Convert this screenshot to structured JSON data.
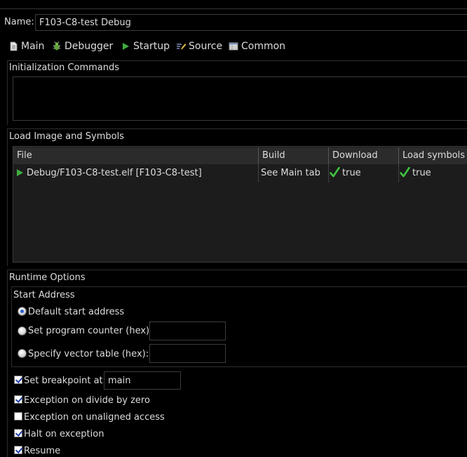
{
  "name": {
    "label": "Name:",
    "value": "F103-C8-test Debug"
  },
  "tabs": [
    {
      "label": "Main",
      "icon": "main-page-icon"
    },
    {
      "label": "Debugger",
      "icon": "debugger-bug-icon"
    },
    {
      "label": "Startup",
      "icon": "startup-play-icon"
    },
    {
      "label": "Source",
      "icon": "source-edit-icon"
    },
    {
      "label": "Common",
      "icon": "common-table-icon"
    }
  ],
  "init_commands": {
    "title": "Initialization Commands",
    "value": ""
  },
  "load_image": {
    "title": "Load Image and Symbols",
    "columns": [
      "File",
      "Build",
      "Download",
      "Load symbols"
    ],
    "rows": [
      {
        "file": "Debug/F103-C8-test.elf [F103-C8-test]",
        "build": "See Main tab",
        "download": "true",
        "load_symbols": "true"
      }
    ]
  },
  "runtime": {
    "title": "Runtime Options",
    "start_address": {
      "title": "Start Address",
      "options": [
        {
          "label": "Default start address",
          "selected": true
        },
        {
          "label": "Set program counter (hex):",
          "selected": false,
          "value": ""
        },
        {
          "label": "Specify vector table (hex):",
          "selected": false,
          "value": ""
        }
      ]
    },
    "set_breakpoint": {
      "label": "Set breakpoint at:",
      "checked": true,
      "value": "main"
    },
    "checks": [
      {
        "label": "Exception on divide by zero",
        "checked": true
      },
      {
        "label": "Exception on unaligned access",
        "checked": false
      },
      {
        "label": "Halt on exception",
        "checked": true
      },
      {
        "label": "Resume",
        "checked": true
      }
    ]
  },
  "colors": {
    "background": "#000000",
    "text": "#dddddd",
    "header": "#2b2b2b",
    "check_green": "#3fc43f",
    "play_green": "#3fae3f"
  }
}
